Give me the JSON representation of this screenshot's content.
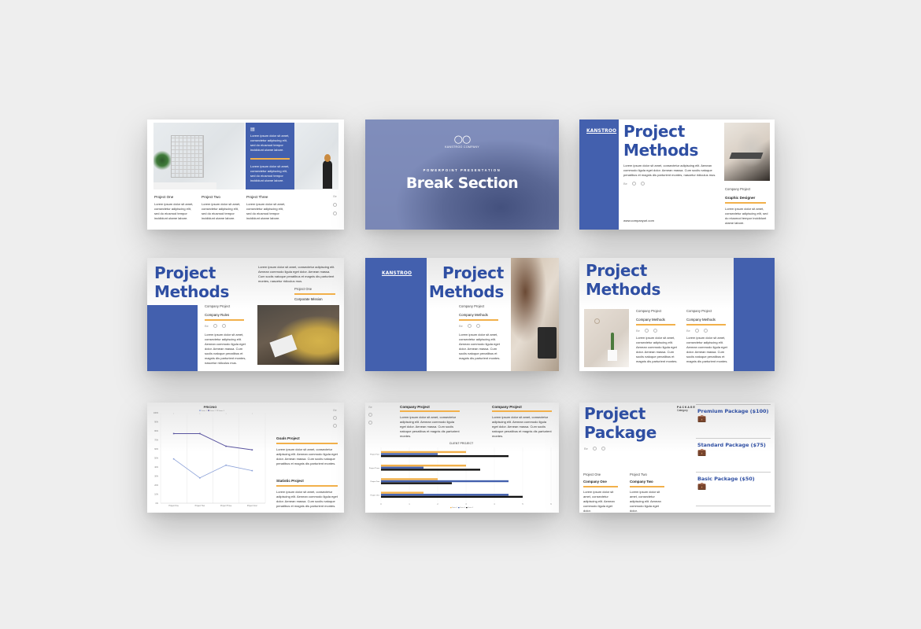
{
  "colors": {
    "brand_blue": "#4360ae",
    "title_blue": "#2f4fa3",
    "accent_orange": "#f2b04a",
    "bar_black": "#111111",
    "line_dark": "#5a55a0",
    "line_light": "#8aa0d8"
  },
  "lorem": {
    "short": "Lorem ipsum dolor sit amet, consectetur adipiscing elit, sed do eiusmod tempor incididunt utame labore.",
    "medium": "Lorem ipsum dolor sit amet, consectetur adipiscing elit. Aenean commodo ligula eget dolor. Aenean massa. Cum sociis natoque penatibus et magnis dis parturient montes.",
    "long": "Lorem ipsum dolor sit amet, consectetur adipiscing elit. Aenean commodo ligula eget dolor. Aenean massa. Cum sociis natoque penatibus et magnis dis parturient montes, nascetur ridiculus mus."
  },
  "social": {
    "behance": "Be"
  },
  "slide1": {
    "card_text_1": "Lorem ipsum dolor sit amet, consectetur adipiscing elit, sed do eiusmod tempor incididunt utame labore.",
    "card_text_2": "Lorem ipsum dolor sit amet, consectetur adipiscing elit, sed do eiusmod tempor incididunt utame labore.",
    "projects": [
      {
        "title": "Project One",
        "text": "Lorem ipsum dolor sit amet, consectetur adipiscing elit, sed do eiusmod tempor incididunt utame labore."
      },
      {
        "title": "Project Two",
        "text": "Lorem ipsum dolor sit amet, consectetur adipiscing elit, sed do eiusmod tempor incididunt utame labore."
      },
      {
        "title": "Project Three",
        "text": "Lorem ipsum dolor sit amet, consectetur adipiscing elit, sed do eiusmod tempor incididunt utame labore."
      }
    ]
  },
  "slide2": {
    "logo_text": "KANSTROO COMPANY",
    "subtitle": "POWERPOINT PRESENTATION",
    "title": "Break Section"
  },
  "slide3": {
    "logo": "KANSTROO",
    "title_line1": "Project",
    "title_line2": "Methods",
    "body": "Lorem ipsum dolor sit amet, consectetur adipiscing elit. Aenean commodo ligula eget dolor. Aenean massa. Cum sociis natoque penatibus et magnis dis parturient montes, nascetur ridiculus mus.",
    "website": "www.companyurl.com",
    "label": "Company Project",
    "role": "Graphic Designer",
    "role_text": "Lorem ipsum dolor sit amet, consectetur adipiscing elit, sed do eiusmod tempor incididunt utame labore."
  },
  "slide4": {
    "title_line1": "Project",
    "title_line2": "Methods",
    "top_text": "Lorem ipsum dolor sit amet, consectetur adipiscing elit. Aenean commodo ligula eget dolor. Aenean massa. Cum sociis natoque penatibus et magnis dis parturient montes, nascetur ridiculus mus.",
    "label_right": "Project One",
    "head_right": "Corporate Mission",
    "label": "Company Project",
    "head": "Company Rules",
    "body": "Lorem ipsum dolor sit amet, consectetur adipiscing elit. Aenean commodo ligula eget dolor. Aenean massa. Cum sociis natoque penatibus et magnis dis parturient montes, nascetur ridiculus mus."
  },
  "slide5": {
    "logo": "KANSTROO",
    "title_line1": "Project",
    "title_line2": "Methods",
    "label": "Company Project",
    "head": "Company Methods",
    "body": "Lorem ipsum dolor sit amet, consectetur adipiscing elit. Aenean commodo ligula eget dolor. Aenean massa. Cum sociis natoque penatibus et magnis dis parturient montes."
  },
  "slide6": {
    "title_line1": "Project",
    "title_line2": "Methods",
    "columns": [
      {
        "label": "Company Project",
        "head": "Company Methods",
        "body": "Lorem ipsum dolor sit amet, consectetur adipiscing elit. Aenean commodo ligula eget dolor. Aenean massa. Cum sociis natoque penatibus et magnis dis parturient montes."
      },
      {
        "label": "Company Project",
        "head": "Company Methods",
        "body": "Lorem ipsum dolor sit amet, consectetur adipiscing elit. Aenean commodo ligula eget dolor. Aenean massa. Cum sociis natoque penatibus et magnis dis parturient montes."
      }
    ]
  },
  "slide7": {
    "blocks": [
      {
        "head": "Goals Project",
        "body": "Lorem ipsum dolor sit amet, consectetur adipiscing elit. Aenean commodo ligula eget dolor. Aenean massa. Cum sociis natoque penatibus et magnis dis parturient montes."
      },
      {
        "head": "Statistic Project",
        "body": "Lorem ipsum dolor sit amet, consectetur adipiscing elit. Aenean commodo ligula eget dolor. Aenean massa. Cum sociis natoque penatibus et magnis dis parturient montes."
      }
    ]
  },
  "slide8": {
    "blocks": [
      {
        "head": "Company Project",
        "body": "Lorem ipsum dolor sit amet, consectetur adipiscing elit. Aenean commodo ligula eget dolor. Aenean massa. Cum sociis natoque penatibus et magnis dis parturient montes."
      },
      {
        "head": "Company Project",
        "body": "Lorem ipsum dolor sit amet, consectetur adipiscing elit. Aenean commodo ligula eget dolor. Aenean massa. Cum sociis natoque penatibus et magnis dis parturient montes."
      }
    ]
  },
  "slide9": {
    "title_line1": "Project",
    "title_line2": "Package",
    "category_label": "PACKAGE",
    "category_sub": "Category",
    "packages": [
      {
        "name": "Premium Package ($100)"
      },
      {
        "name": "Standard Package ($75)"
      },
      {
        "name": "Basic Package ($50)"
      }
    ],
    "companies": [
      {
        "label": "Project One",
        "head": "Company One",
        "body": "Lorem ipsum dolor sit amet, consectetur adipiscing elit. Aenean commodo ligula eget dolor."
      },
      {
        "label": "Project Two",
        "head": "Company Two",
        "body": "Lorem ipsum dolor sit amet, consectetur adipiscing elit. Aenean commodo ligula eget dolor."
      }
    ]
  },
  "chart_data": [
    {
      "type": "line",
      "title": "PRICING",
      "categories": [
        "Project One",
        "Project Two",
        "Project Three",
        "Project Four"
      ],
      "series": [
        {
          "name": "Series 1",
          "values": [
            49,
            28,
            42,
            36
          ]
        },
        {
          "name": "Series 2",
          "values": [
            77,
            77,
            63,
            59
          ]
        },
        {
          "name": "Series 3",
          "values": []
        }
      ],
      "yticks": [
        "0%",
        "10%",
        "20%",
        "30%",
        "40%",
        "50%",
        "60%",
        "70%",
        "80%",
        "90%",
        "100%"
      ],
      "ylim": [
        0,
        100
      ],
      "xlabel": "",
      "ylabel": "",
      "grid": true,
      "legend": "top"
    },
    {
      "type": "bar",
      "orientation": "horizontal",
      "title": "CLIENT PROJECT",
      "categories": [
        "Project One",
        "Project Two",
        "Project Three",
        "Project Four"
      ],
      "series": [
        {
          "name": "Series 1",
          "values": [
            1.5,
            2.0,
            3.0,
            3.0
          ]
        },
        {
          "name": "Series 2",
          "values": [
            4.5,
            4.5,
            1.5,
            2.0
          ]
        },
        {
          "name": "Series 3",
          "values": [
            5.0,
            2.5,
            3.5,
            4.5
          ]
        }
      ],
      "xticks": [
        "0",
        "1",
        "2",
        "3",
        "4",
        "5",
        "6"
      ],
      "xlim": [
        0,
        6
      ],
      "grid": true,
      "legend": "bottom"
    }
  ]
}
